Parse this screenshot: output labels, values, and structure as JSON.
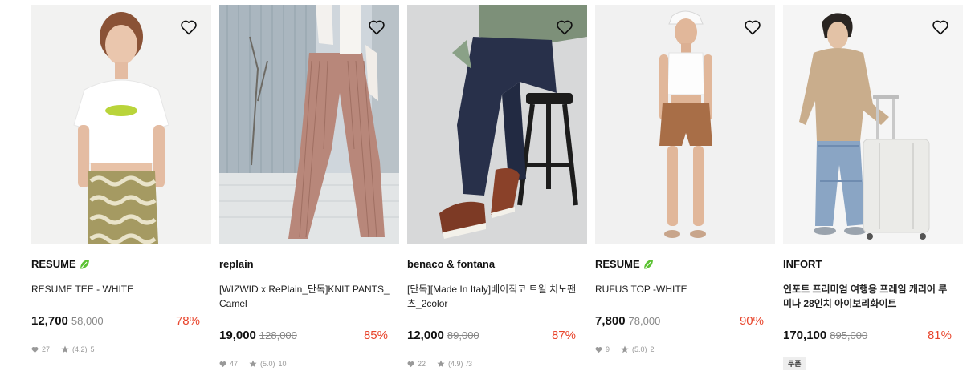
{
  "colors": {
    "discount": "#e8452c",
    "leaf": "#5cc233",
    "meta": "#999999"
  },
  "icons": {
    "wishlist": "heart-outline-icon",
    "like": "heart-icon",
    "rating": "star-icon",
    "eco": "leaf-icon"
  },
  "products": [
    {
      "brand": "RESUME",
      "eco_badge": true,
      "title": "RESUME TEE - WHITE",
      "price": "12,700",
      "original_price": "58,000",
      "discount": "78%",
      "likes": "27",
      "rating": "(4.2)",
      "reviews": "5"
    },
    {
      "brand": "replain",
      "eco_badge": false,
      "title": "[WIZWID x RePlain_단독]KNIT PANTS_Camel",
      "price": "19,000",
      "original_price": "128,000",
      "discount": "85%",
      "likes": "47",
      "rating": "(5.0)",
      "reviews": "10"
    },
    {
      "brand": "benaco & fontana",
      "eco_badge": false,
      "title": "[단독][Made In Italy]베이직코 트윌 치노팬츠_2color",
      "price": "12,000",
      "original_price": "89,000",
      "discount": "87%",
      "likes": "22",
      "rating": "(4.9)",
      "reviews": "/3"
    },
    {
      "brand": "RESUME",
      "eco_badge": true,
      "title": "RUFUS TOP -WHITE",
      "price": "7,800",
      "original_price": "78,000",
      "discount": "90%",
      "likes": "9",
      "rating": "(5.0)",
      "reviews": "2"
    },
    {
      "brand": "INFORT",
      "eco_badge": false,
      "title": "인포트 프리미엄 여행용 프레임 캐리어 루미나 28인치 아이보리화이트",
      "price": "170,100",
      "original_price": "895,000",
      "discount": "81%",
      "coupon": "쿠폰"
    }
  ]
}
